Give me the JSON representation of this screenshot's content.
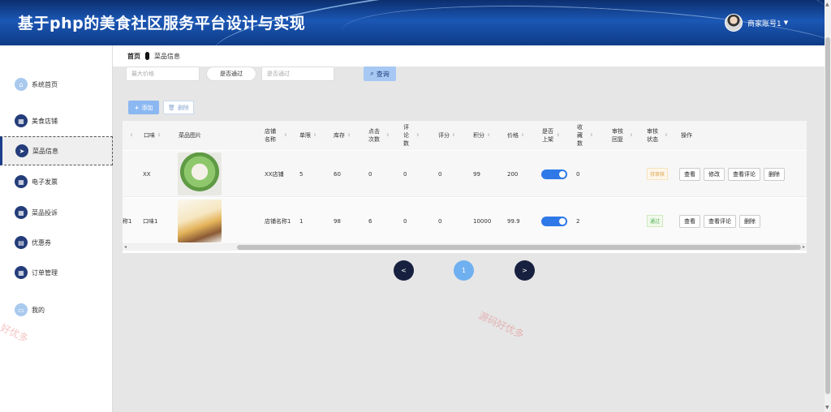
{
  "app": {
    "title": "基于php的美食社区服务平台设计与实现"
  },
  "user": {
    "name": "商家账号1",
    "caret": "▼"
  },
  "sidebar": {
    "items": [
      {
        "label": "系统首页",
        "icon": "home-icon"
      },
      {
        "label": "美食店铺",
        "icon": "grid-icon"
      },
      {
        "label": "菜品信息",
        "icon": "send-icon",
        "active": true
      },
      {
        "label": "电子发票",
        "icon": "grid-icon"
      },
      {
        "label": "菜品投诉",
        "icon": "grid-icon"
      },
      {
        "label": "优惠券",
        "icon": "ticket-icon"
      },
      {
        "label": "订单管理",
        "icon": "grid-icon"
      },
      {
        "label": "我的",
        "icon": "user-card-icon"
      }
    ]
  },
  "breadcrumb": {
    "home": "首页",
    "current": "菜品信息"
  },
  "search": {
    "max_price_placeholder": "最大价格",
    "approved_select": "是否通过",
    "approved_placeholder": "是否通过",
    "query_label": "查询"
  },
  "actions": {
    "add_label": "添加",
    "delete_label": "删除"
  },
  "table": {
    "headers": [
      "口味",
      "菜品图片",
      "店铺名称",
      "单限",
      "库存",
      "点击次数",
      "评论数",
      "评分",
      "积分",
      "价格",
      "是否上架",
      "收藏数",
      "审核回复",
      "审核状态",
      "操作"
    ],
    "rows": [
      {
        "prefix": "",
        "taste": "XX",
        "shop": "XX店铺",
        "limit": "5",
        "stock": "60",
        "clicks": "0",
        "comments": "0",
        "rating": "0",
        "points": "99",
        "price": "200",
        "favorites": "0",
        "status": "待审核",
        "ops": [
          "查看",
          "修改",
          "查看评论",
          "删除"
        ]
      },
      {
        "prefix": "称1",
        "taste": "口味1",
        "shop": "店铺名称1",
        "limit": "1",
        "stock": "98",
        "clicks": "6",
        "comments": "0",
        "rating": "0",
        "points": "10000",
        "price": "99.9",
        "favorites": "2",
        "status": "通过",
        "ops": [
          "查看",
          "查看评论",
          "删除"
        ]
      }
    ]
  },
  "pagination": {
    "prev": "<",
    "current": "1",
    "next": ">"
  },
  "watermark": {
    "text": "源码好优多",
    "partial": "好优多"
  }
}
